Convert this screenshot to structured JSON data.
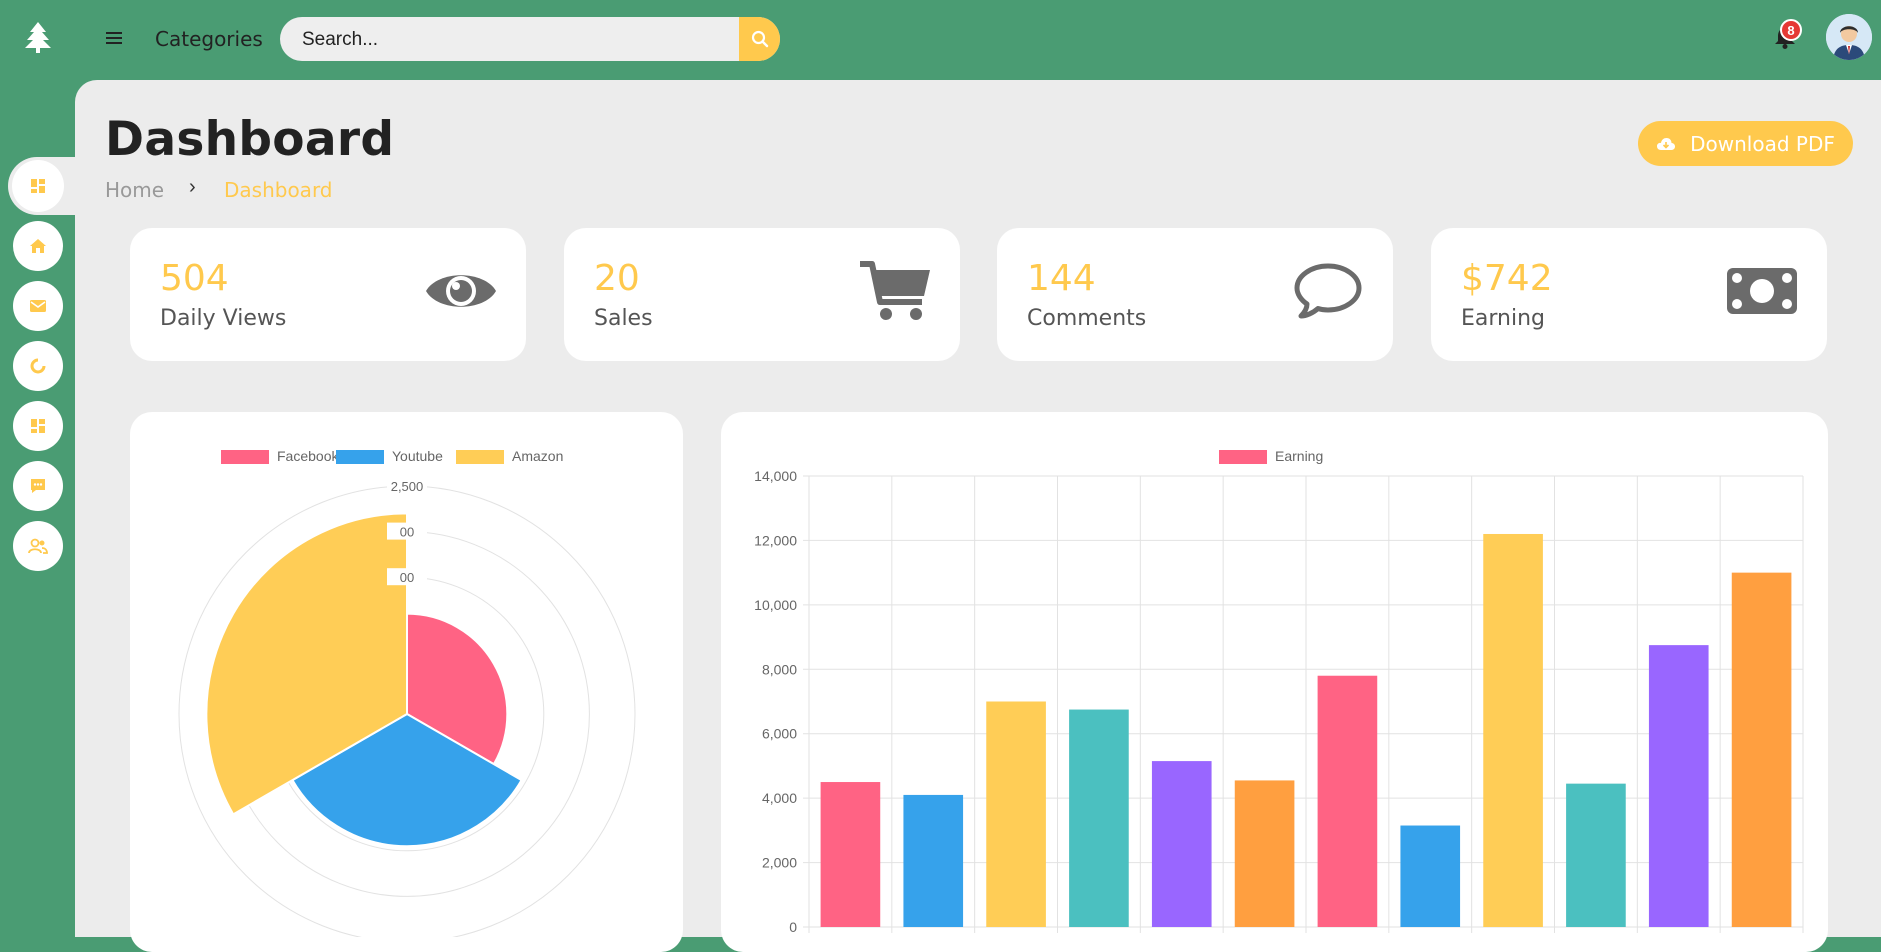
{
  "header": {
    "categories_label": "Categories",
    "search_placeholder": "Search...",
    "notification_count": "8"
  },
  "sidebar": {
    "items": [
      "dashboard-icon",
      "home-icon",
      "mail-icon",
      "pie-chart-icon",
      "grid-icon",
      "chat-icon",
      "users-icon"
    ],
    "active_index": 0
  },
  "page": {
    "title": "Dashboard",
    "breadcrumb": {
      "home": "Home",
      "separator": "›",
      "current": "Dashboard"
    },
    "download_label": "Download PDF"
  },
  "cards": [
    {
      "value": "504",
      "label": "Daily Views",
      "icon": "eye-icon"
    },
    {
      "value": "20",
      "label": "Sales",
      "icon": "cart-icon"
    },
    {
      "value": "144",
      "label": "Comments",
      "icon": "comment-icon"
    },
    {
      "value": "$742",
      "label": "Earning",
      "icon": "money-icon"
    }
  ],
  "colors": {
    "header_green": "#4a9c73",
    "accent_yellow": "#ffc94d",
    "background": "#ececec",
    "badge_red": "#e53935"
  },
  "chart_data": [
    {
      "type": "polarArea",
      "legend": [
        "Facebook",
        "Youtube",
        "Amazon"
      ],
      "legend_position": "top",
      "series_colors": [
        "#ff6384",
        "#36a2eb",
        "#ffcd56"
      ],
      "values": [
        1100,
        1450,
        2200
      ],
      "r_max": 2500,
      "r_ticks": [
        "2,500",
        "00",
        "00"
      ]
    },
    {
      "type": "bar",
      "legend": [
        "Earning"
      ],
      "legend_position": "top",
      "values": [
        4500,
        4100,
        7000,
        6750,
        5150,
        4550,
        7800,
        3150,
        12200,
        4450,
        8750,
        11000
      ],
      "bar_colors": [
        "#ff6384",
        "#36a2eb",
        "#ffcd56",
        "#4bc0c0",
        "#9966ff",
        "#ff9f40",
        "#ff6384",
        "#36a2eb",
        "#ffcd56",
        "#4bc0c0",
        "#9966ff",
        "#ff9f40"
      ],
      "ylim": [
        0,
        14000
      ],
      "yticks": [
        "0",
        "2,000",
        "4,000",
        "6,000",
        "8,000",
        "10,000",
        "12,000",
        "14,000"
      ],
      "grid": true
    }
  ]
}
